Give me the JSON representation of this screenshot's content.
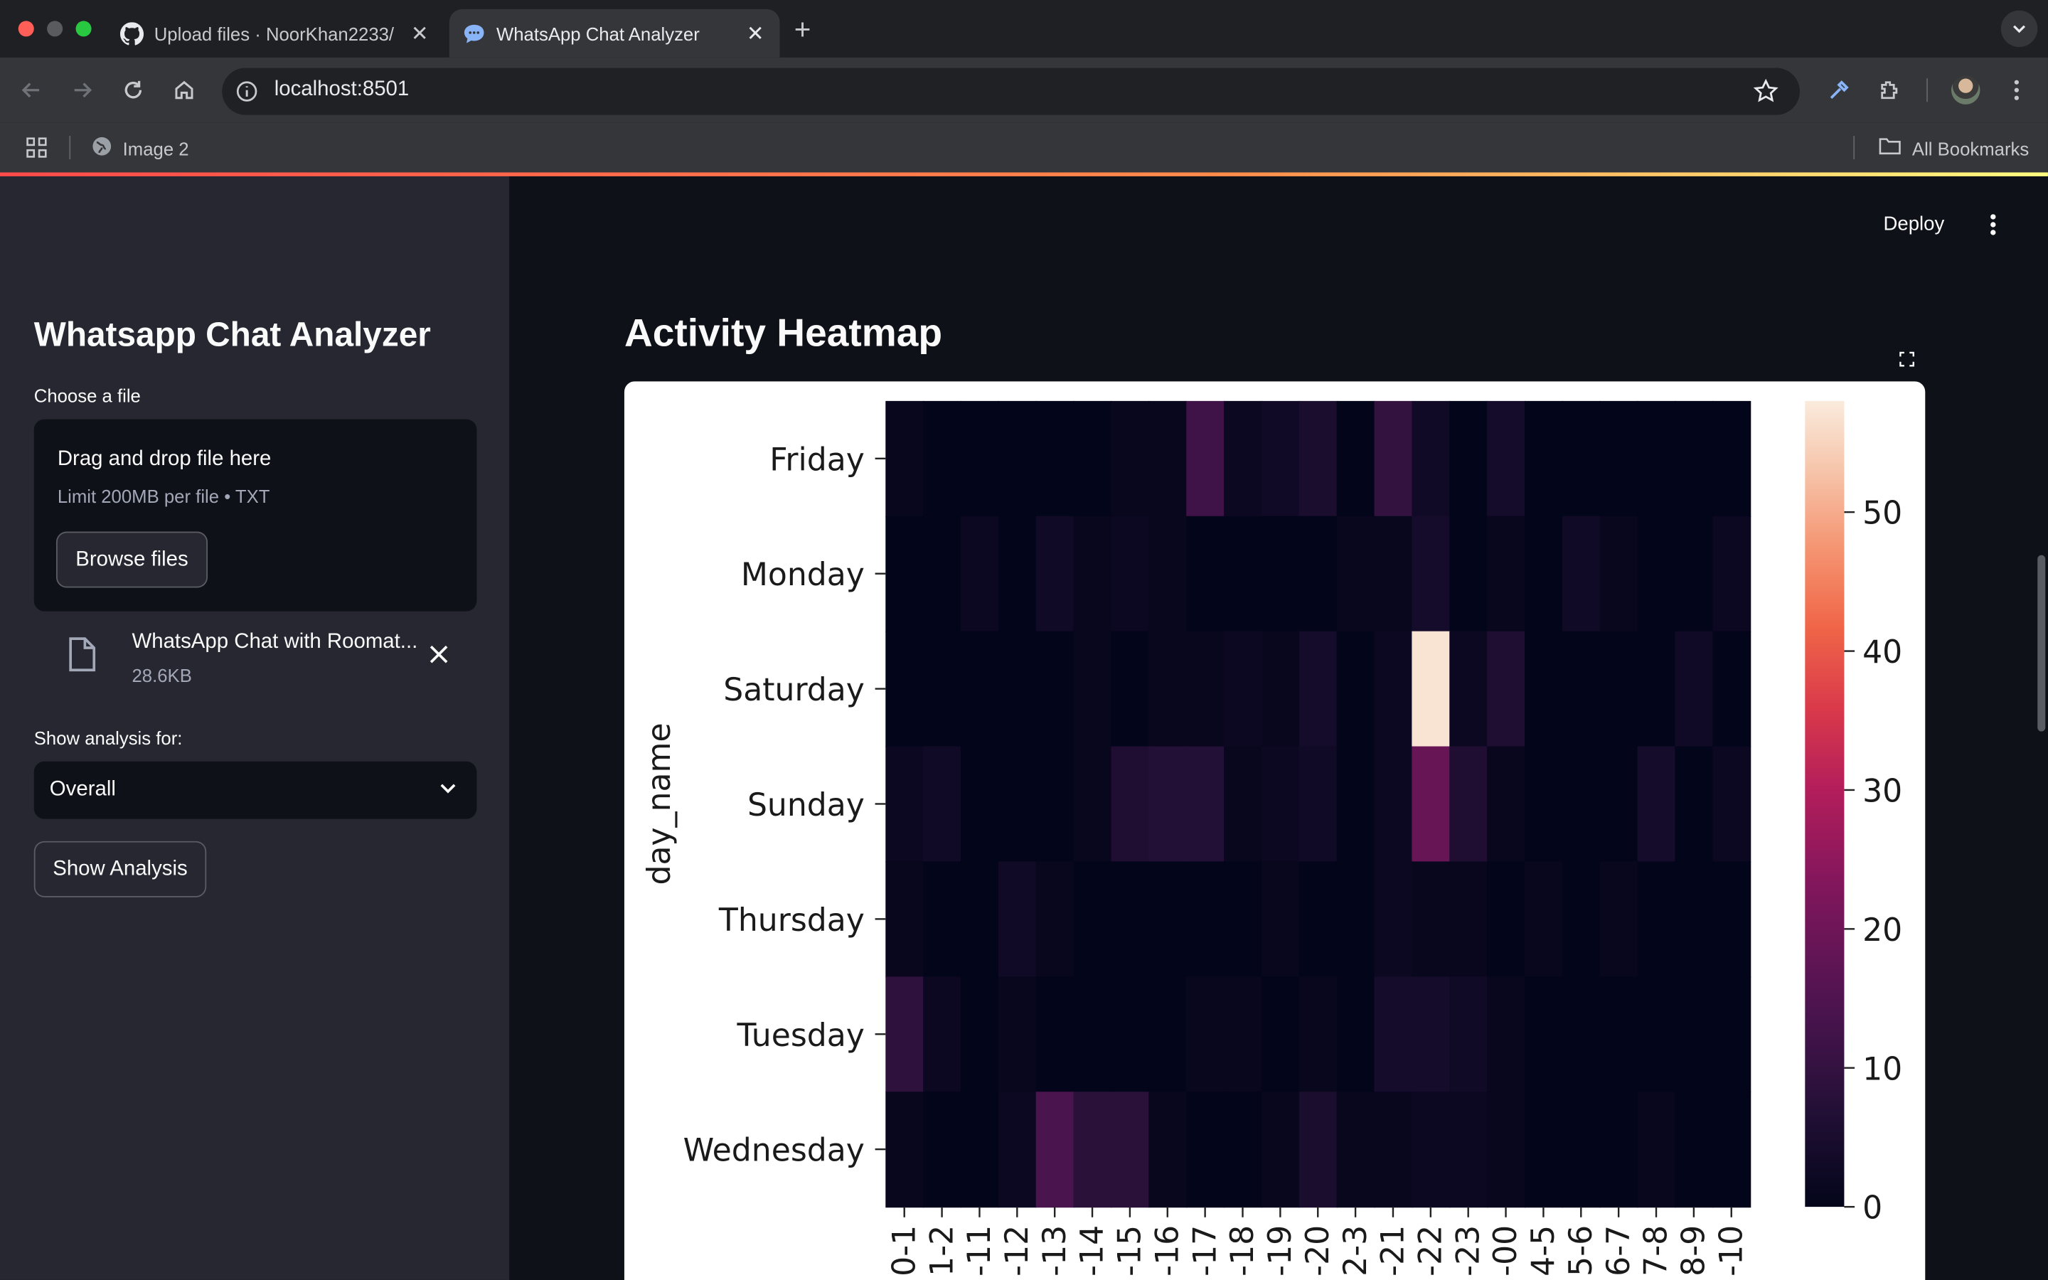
{
  "browser": {
    "tabs": [
      {
        "title": "Upload files · NoorKhan2233/",
        "icon": "github-icon",
        "active": false
      },
      {
        "title": "WhatsApp Chat Analyzer",
        "icon": "chat-bubble-icon",
        "active": true
      }
    ],
    "url": "localhost:8501",
    "bookmarks": [
      {
        "label": "Image 2",
        "icon": "globe-icon"
      }
    ],
    "all_bookmarks_label": "All Bookmarks"
  },
  "header": {
    "deploy_label": "Deploy"
  },
  "sidebar": {
    "title": "Whatsapp Chat Analyzer",
    "uploader_label": "Choose a file",
    "dropzone_title": "Drag and drop file here",
    "dropzone_limit": "Limit 200MB per file • TXT",
    "browse_label": "Browse files",
    "file_name": "WhatsApp Chat with Roomat...",
    "file_size": "28.6KB",
    "select_label": "Show analysis for:",
    "select_value": "Overall",
    "show_analysis_label": "Show Analysis"
  },
  "main": {
    "section_title": "Activity Heatmap"
  },
  "chart_data": {
    "type": "heatmap",
    "ylabel": "day_name",
    "rows": [
      "Friday",
      "Monday",
      "Saturday",
      "Sunday",
      "Thursday",
      "Tuesday",
      "Wednesday"
    ],
    "columns": [
      "0-1",
      "1-2",
      "-11",
      "-12",
      "-13",
      "-14",
      "-15",
      "-16",
      "-17",
      "-18",
      "-19",
      "-20",
      "2-3",
      "-21",
      "-22",
      "-23",
      "-00",
      "4-5",
      "5-6",
      "6-7",
      "7-8",
      "8-9",
      "-10"
    ],
    "values": [
      [
        1,
        0,
        0,
        0,
        0,
        0,
        1,
        1,
        12,
        2,
        3,
        5,
        0,
        10,
        3,
        0,
        4,
        0,
        0,
        0,
        0,
        0,
        0
      ],
      [
        0,
        0,
        2,
        0,
        3,
        1,
        2,
        1,
        0,
        0,
        0,
        0,
        1,
        1,
        4,
        0,
        1,
        0,
        3,
        1,
        0,
        0,
        2
      ],
      [
        0,
        0,
        0,
        0,
        0,
        1,
        0,
        1,
        1,
        2,
        1,
        4,
        0,
        2,
        57,
        2,
        6,
        0,
        0,
        0,
        0,
        3,
        0
      ],
      [
        2,
        3,
        0,
        0,
        0,
        1,
        6,
        7,
        7,
        1,
        2,
        3,
        0,
        2,
        19,
        6,
        1,
        0,
        0,
        0,
        4,
        0,
        2
      ],
      [
        1,
        0,
        0,
        3,
        1,
        0,
        0,
        0,
        0,
        0,
        1,
        0,
        0,
        2,
        1,
        1,
        0,
        1,
        0,
        1,
        0,
        0,
        0
      ],
      [
        9,
        2,
        0,
        1,
        0,
        0,
        0,
        0,
        1,
        1,
        0,
        1,
        0,
        4,
        4,
        3,
        1,
        0,
        0,
        0,
        0,
        0,
        0
      ],
      [
        1,
        0,
        0,
        2,
        14,
        8,
        8,
        1,
        0,
        0,
        1,
        5,
        1,
        1,
        2,
        2,
        1,
        0,
        0,
        0,
        1,
        0,
        0
      ]
    ],
    "colorbar_ticks": [
      0,
      10,
      20,
      30,
      40,
      50
    ],
    "colorbar_range": [
      0,
      58
    ],
    "colormap": "rocket"
  }
}
